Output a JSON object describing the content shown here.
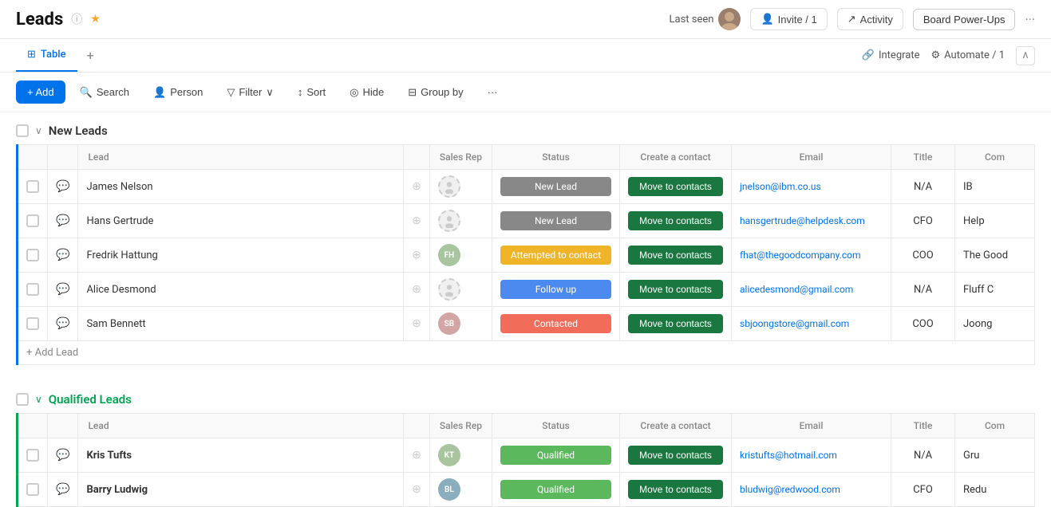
{
  "header": {
    "title": "Leads",
    "info_icon": "ⓘ",
    "star_icon": "★",
    "last_seen_label": "Last seen",
    "invite_label": "Invite / 1",
    "activity_label": "Activity",
    "board_power_label": "Board Power-Ups",
    "more_icon": "···"
  },
  "tabs": {
    "table_label": "Table",
    "add_icon": "+",
    "integrate_label": "Integrate",
    "automate_label": "Automate / 1",
    "collapse_icon": "∧"
  },
  "toolbar": {
    "add_label": "+ Add",
    "search_label": "Search",
    "person_label": "Person",
    "filter_label": "Filter",
    "sort_label": "Sort",
    "hide_label": "Hide",
    "group_by_label": "Group by",
    "more_icon": "···"
  },
  "new_leads_group": {
    "title": "New Leads",
    "columns": {
      "lead": "Lead",
      "sales_rep": "Sales Rep",
      "status": "Status",
      "create_contact": "Create a contact",
      "email": "Email",
      "title": "Title",
      "company": "Com"
    },
    "rows": [
      {
        "name": "James Nelson",
        "status": "New Lead",
        "status_class": "status-new-lead",
        "email": "jnelson@ibm.co.us",
        "title": "N/A",
        "company": "IB",
        "avatar": null
      },
      {
        "name": "Hans Gertrude",
        "status": "New Lead",
        "status_class": "status-new-lead",
        "email": "hansgertrude@helpdesk.com",
        "title": "CFO",
        "company": "Help",
        "avatar": null
      },
      {
        "name": "Fredrik Hattung",
        "status": "Attempted to contact",
        "status_class": "status-attempted",
        "email": "fhat@thegoodcompany.com",
        "title": "COO",
        "company": "The Good",
        "avatar": "FH"
      },
      {
        "name": "Alice Desmond",
        "status": "Follow up",
        "status_class": "status-follow-up",
        "email": "alicedesmond@gmail.com",
        "title": "N/A",
        "company": "Fluff C",
        "avatar": null
      },
      {
        "name": "Sam Bennett",
        "status": "Contacted",
        "status_class": "status-contacted",
        "email": "sbjoongstore@gmail.com",
        "title": "COO",
        "company": "Joong",
        "avatar": "SB"
      }
    ],
    "add_lead_label": "+ Add Lead",
    "move_contacts_label": "Move to contacts"
  },
  "qualified_leads_group": {
    "title": "Qualified Leads",
    "columns": {
      "lead": "Lead",
      "sales_rep": "Sales Rep",
      "status": "Status",
      "create_contact": "Create a contact",
      "email": "Email",
      "title": "Title",
      "company": "Com"
    },
    "rows": [
      {
        "name": "Kris Tufts",
        "status": "Qualified",
        "status_class": "status-qualified",
        "email": "kristufts@hotmail.com",
        "title": "N/A",
        "company": "Gru",
        "avatar": "KT",
        "bold": true
      },
      {
        "name": "Barry Ludwig",
        "status": "Qualified",
        "status_class": "status-qualified",
        "email": "bludwig@redwood.com",
        "title": "CFO",
        "company": "Redu",
        "avatar": "BL",
        "bold": true
      }
    ],
    "move_contacts_label": "Move to contacts"
  }
}
